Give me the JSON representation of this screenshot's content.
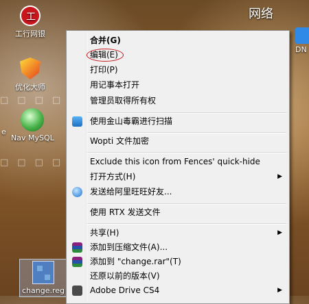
{
  "desktop": {
    "top_right_label": "网络",
    "icons": [
      {
        "label": "工行网银"
      },
      {
        "label": "优化大师"
      },
      {
        "label": "Nav MySQL"
      },
      {
        "label": "change.reg"
      }
    ],
    "right_edge_label": "DN",
    "left_edge_fragment": "e"
  },
  "context_menu": {
    "items": [
      {
        "label": "合并(G)",
        "bold": true
      },
      {
        "label": "编辑(E)",
        "highlighted_with_circle": true
      },
      {
        "label": "打印(P)"
      },
      {
        "label": "用记事本打开"
      },
      {
        "label": "管理员取得所有权"
      },
      {
        "label": "使用金山毒霸进行扫描",
        "icon": "kingsoft-antivirus-icon"
      },
      {
        "label": "Wopti 文件加密"
      },
      {
        "label": "Exclude this icon from Fences' quick-hide"
      },
      {
        "label": "打开方式(H)",
        "submenu": true
      },
      {
        "label": "发送给阿里旺旺好友...",
        "icon": "aliwangwang-icon"
      },
      {
        "label": "使用 RTX 发送文件"
      },
      {
        "label": "共享(H)",
        "submenu": true
      },
      {
        "label": "添加到压缩文件(A)...",
        "icon": "winrar-icon"
      },
      {
        "label": "添加到 \"change.rar\"(T)",
        "icon": "winrar-icon"
      },
      {
        "label": "还原以前的版本(V)"
      },
      {
        "label": "Adobe Drive CS4",
        "icon": "adobe-drive-icon",
        "submenu": true
      }
    ]
  },
  "colors": {
    "menu_background": "#f0f0f0",
    "annotation_circle": "#c4161c"
  }
}
